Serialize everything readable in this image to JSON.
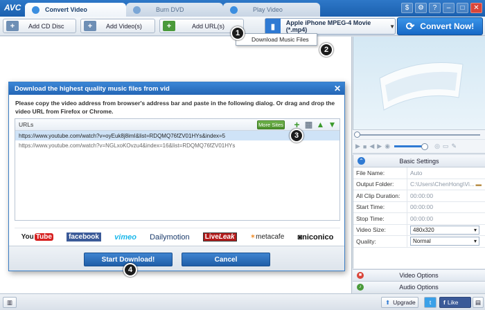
{
  "app": {
    "logo": "AVC",
    "tabs": [
      {
        "label": "Convert Video"
      },
      {
        "label": "Burn DVD"
      },
      {
        "label": "Play Video"
      }
    ],
    "window_buttons": [
      "$",
      "⚙",
      "?",
      "–",
      "□",
      "✕"
    ]
  },
  "toolbar": {
    "add_cd": "Add CD Disc",
    "add_videos": "Add Video(s)",
    "add_url": "Add URL(s)",
    "profile": "Apple iPhone MPEG-4 Movie (*.mp4)",
    "convert_now": "Convert Now!",
    "dropdown_item": "Download Music Files"
  },
  "badges": [
    "1",
    "2",
    "3",
    "4"
  ],
  "dialog": {
    "title": "Download the highest quality music files from vid",
    "close": "✕",
    "instructions": "Please copy the video address from browser's address bar and paste in the following dialog. Or drag and drop the video URL from Firefox or Chrome.",
    "urls_header": "URLs",
    "more_sites": "More Sites",
    "urls": [
      "https://www.youtube.com/watch?v=oyEuk8j8imI&list=RDQMQ76fZV01HYs&index=5",
      "https://www.youtube.com/watch?v=NGLxoKOvzu4&index=16&list=RDQMQ76fZV01HYs"
    ],
    "sites": {
      "youtube_a": "You",
      "youtube_b": "Tube",
      "facebook": "facebook",
      "vimeo": "vimeo",
      "dailymotion": "Dailymotion",
      "liveleak_a": "Live",
      "liveleak_b": "Leak",
      "metacafe": "metacafe",
      "niconico": "niconico"
    },
    "start_download": "Start Download!",
    "cancel": "Cancel"
  },
  "settings": {
    "header": "Basic Settings",
    "rows": [
      {
        "key": "File Name:",
        "value": "Auto"
      },
      {
        "key": "Output Folder:",
        "value": "C:\\Users\\ChenHong\\Vi..."
      },
      {
        "key": "All Clip Duration:",
        "value": "00:00:00"
      },
      {
        "key": "Start Time:",
        "value": "00:00:00"
      },
      {
        "key": "Stop Time:",
        "value": "00:00:00"
      },
      {
        "key": "Video Size:",
        "value": "480x320"
      },
      {
        "key": "Quality:",
        "value": "Normal"
      }
    ],
    "video_options": "Video Options",
    "audio_options": "Audio Options"
  },
  "statusbar": {
    "upgrade": "Upgrade",
    "like": "Like"
  },
  "colors": {
    "accent": "#1a5fae",
    "convert": "#1668c6",
    "green": "#4a8f2b"
  }
}
